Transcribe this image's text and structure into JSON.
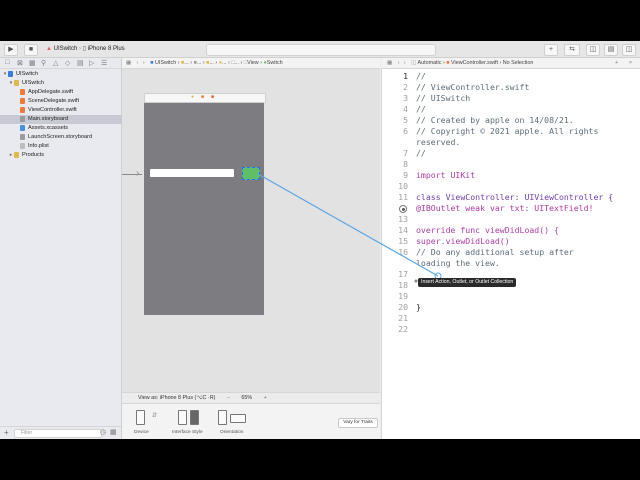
{
  "toolbar": {
    "scheme": "UISwitch",
    "device": "iPhone 8 Plus",
    "add_icon": "+",
    "library_icon": "plus-square-icon"
  },
  "navigator": {
    "tabs": [
      "folder-icon",
      "source-control-icon",
      "symbol-icon",
      "find-icon",
      "issue-icon",
      "test-icon",
      "debug-icon",
      "breakpoint-icon",
      "report-icon"
    ],
    "items": [
      {
        "label": "UISwitch",
        "level": 0,
        "kind": "project",
        "selected": false
      },
      {
        "label": "UISwitch",
        "level": 1,
        "kind": "folder",
        "selected": false
      },
      {
        "label": "AppDelegate.swift",
        "level": 2,
        "kind": "swift",
        "selected": false
      },
      {
        "label": "SceneDelegate.swift",
        "level": 2,
        "kind": "swift",
        "selected": false
      },
      {
        "label": "ViewController.swift",
        "level": 2,
        "kind": "swift",
        "selected": false
      },
      {
        "label": "Main.storyboard",
        "level": 2,
        "kind": "storyboard",
        "selected": true
      },
      {
        "label": "Assets.xcassets",
        "level": 2,
        "kind": "assets",
        "selected": false
      },
      {
        "label": "LaunchScreen.storyboard",
        "level": 2,
        "kind": "storyboard",
        "selected": false
      },
      {
        "label": "Info.plist",
        "level": 2,
        "kind": "plist",
        "selected": false
      },
      {
        "label": "Products",
        "level": 1,
        "kind": "folder",
        "selected": false
      }
    ],
    "filter_placeholder": "Filter"
  },
  "ib_jumpbar": {
    "items": [
      "UISwitch",
      "...",
      "...",
      "...",
      "...",
      "...",
      "View",
      "Switch"
    ]
  },
  "assistant_jumpbar": {
    "mode": "Automatic",
    "file": "ViewController.swift",
    "selection": "No Selection"
  },
  "canvas": {
    "view_as": "View as: iPhone 8 Plus (⌥C ·R)",
    "zoom": "65%",
    "zoom_out": "–",
    "zoom_in": "+",
    "device_label": "Device",
    "interface_label": "Interface Style",
    "orientation_label": "Orientation",
    "vary_label": "Vary for Traits"
  },
  "code": {
    "lines": [
      {
        "n": "1",
        "t": "//"
      },
      {
        "n": "2",
        "t": "//  ViewController.swift"
      },
      {
        "n": "3",
        "t": "//  UISwitch"
      },
      {
        "n": "4",
        "t": "//"
      },
      {
        "n": "5",
        "t": "//  Created by apple on 14/08/21."
      },
      {
        "n": "6",
        "t": "//  Copyright © 2021 apple. All rights"
      },
      {
        "n": "",
        "t": "    reserved."
      },
      {
        "n": "7",
        "t": "//"
      },
      {
        "n": "8",
        "t": ""
      },
      {
        "n": "9",
        "t": "import UIKit"
      },
      {
        "n": "10",
        "t": ""
      },
      {
        "n": "11",
        "t": "class ViewController: UIViewController {"
      },
      {
        "n": "12",
        "t": "    @IBOutlet weak var txt: UITextField!"
      },
      {
        "n": "13",
        "t": ""
      },
      {
        "n": "14",
        "t": "    override func viewDidLoad() {"
      },
      {
        "n": "15",
        "t": "        super.viewDidLoad()"
      },
      {
        "n": "16",
        "t": "        // Do any additional setup after"
      },
      {
        "n": "",
        "t": "            loading the view."
      },
      {
        "n": "17",
        "t": ""
      },
      {
        "n": "18",
        "t": ""
      },
      {
        "n": "19",
        "t": ""
      },
      {
        "n": "20",
        "t": "}"
      },
      {
        "n": "21",
        "t": ""
      },
      {
        "n": "22",
        "t": ""
      }
    ]
  },
  "tooltip": "Insert Action, Outlet, or Outlet Collection",
  "colors": {
    "connection_line": "#5aa5e6",
    "switch_on": "#5fbf68",
    "selection": "#2b6bff"
  }
}
